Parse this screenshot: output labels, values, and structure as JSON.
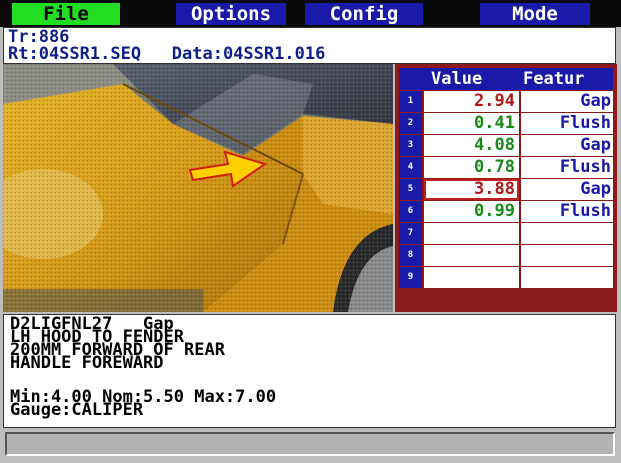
{
  "menu": {
    "file": "File",
    "options": "Options",
    "config": "Config",
    "mode": "Mode"
  },
  "header": {
    "tr": "Tr:886",
    "rt": "Rt:04SSR1.SEQ",
    "data": "Data:04SSR1.016"
  },
  "table": {
    "columns": [
      "Value",
      "Featur"
    ],
    "rows": [
      {
        "n": "1",
        "value": "2.94",
        "feature": "Gap",
        "value_color": "#b01818"
      },
      {
        "n": "2",
        "value": "0.41",
        "feature": "Flush",
        "value_color": "#1a8a1a"
      },
      {
        "n": "3",
        "value": "4.08",
        "feature": "Gap",
        "value_color": "#1a8a1a"
      },
      {
        "n": "4",
        "value": "0.78",
        "feature": "Flush",
        "value_color": "#1a8a1a"
      },
      {
        "n": "5",
        "value": "3.88",
        "feature": "Gap",
        "value_color": "#b01818",
        "selected": true
      },
      {
        "n": "6",
        "value": "0.99",
        "feature": "Flush",
        "value_color": "#1a8a1a"
      },
      {
        "n": "7",
        "value": "",
        "feature": ""
      },
      {
        "n": "8",
        "value": "",
        "feature": ""
      },
      {
        "n": "9",
        "value": "",
        "feature": ""
      }
    ]
  },
  "info": {
    "line1": "D2LIGFNL27   Gap",
    "line2": "LH HOOD TO FENDER",
    "line3": "200MM FORWARD OF REAR",
    "line4": "HANDLE FOREWARD",
    "line5": "Min:4.00 Nom:5.50 Max:7.00",
    "line6": "Gauge:CALIPER"
  },
  "status": {
    "text": ""
  },
  "colors": {
    "menu_active": "#22dd22",
    "menu": "#1a1aa8",
    "table_frame": "#8c1a1a",
    "arrow": "#ffd000"
  }
}
